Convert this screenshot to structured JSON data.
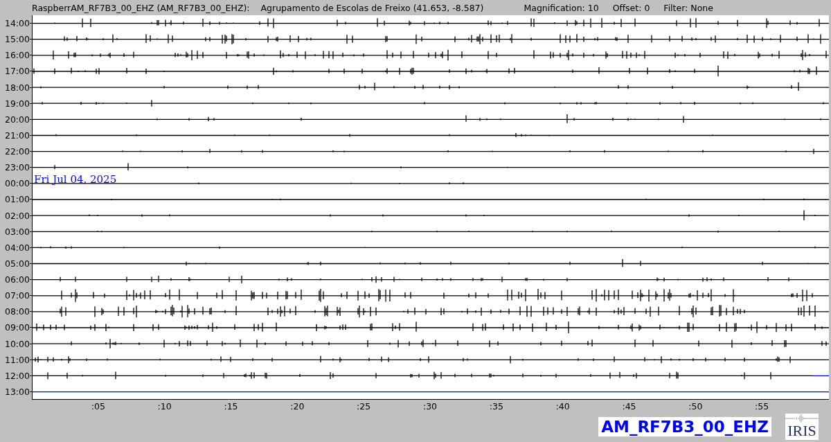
{
  "header": {
    "station": "RaspberrAM_RF7B3_00_EHZ (AM_RF7B3_00_EHZ):",
    "location": "Agrupamento de Escolas de Freixo (41.653, -8.587)",
    "magnification": "Magnification: 10",
    "offset": "Offset: 0",
    "filter": "Filter: None"
  },
  "rows": [
    {
      "label": "14:00",
      "kind": "recorded"
    },
    {
      "label": "15:00",
      "kind": "recorded"
    },
    {
      "label": "16:00",
      "kind": "recorded"
    },
    {
      "label": "17:00",
      "kind": "recorded"
    },
    {
      "label": "18:00",
      "kind": "recorded"
    },
    {
      "label": "19:00",
      "kind": "recorded"
    },
    {
      "label": "20:00",
      "kind": "recorded"
    },
    {
      "label": "21:00",
      "kind": "recorded"
    },
    {
      "label": "22:00",
      "kind": "recorded"
    },
    {
      "label": "23:00",
      "kind": "recorded"
    },
    {
      "label": "00:00",
      "kind": "recorded",
      "date": "Fri Jul 04, 2025"
    },
    {
      "label": "01:00",
      "kind": "recorded"
    },
    {
      "label": "02:00",
      "kind": "recorded"
    },
    {
      "label": "03:00",
      "kind": "recorded"
    },
    {
      "label": "04:00",
      "kind": "recorded"
    },
    {
      "label": "05:00",
      "kind": "recorded"
    },
    {
      "label": "06:00",
      "kind": "recorded"
    },
    {
      "label": "07:00",
      "kind": "recorded"
    },
    {
      "label": "08:00",
      "kind": "recorded"
    },
    {
      "label": "09:00",
      "kind": "recorded"
    },
    {
      "label": "10:00",
      "kind": "recorded"
    },
    {
      "label": "11:00",
      "kind": "recorded"
    },
    {
      "label": "12:00",
      "kind": "partial",
      "level": 0.98
    },
    {
      "label": "13:00",
      "kind": "pending"
    }
  ],
  "x_axis": [
    ":05",
    ":10",
    ":15",
    ":20",
    ":25",
    ":30",
    ":35",
    ":40",
    ":45",
    ":50",
    ":55"
  ],
  "channel_label": "AM_RF7B3_00_EHZ",
  "logo": "IRIS"
}
